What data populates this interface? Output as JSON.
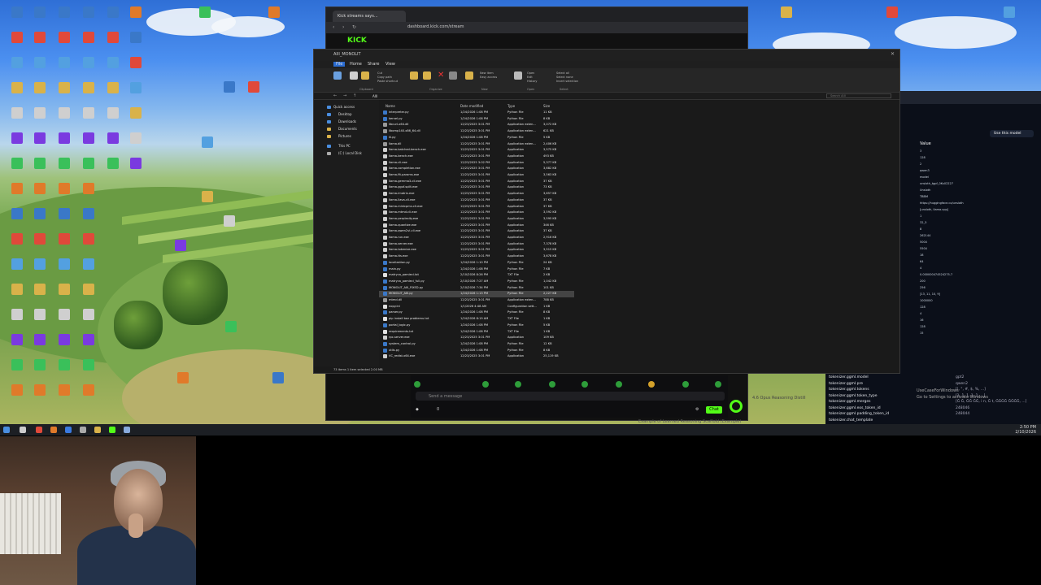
{
  "browser": {
    "tab_title": "Kick streams says...",
    "url": "dashboard.kick.com/stream"
  },
  "explorer": {
    "title": "AIII_MONOLIT",
    "menus": [
      "File",
      "Home",
      "Share",
      "View"
    ],
    "ribbon_groups": [
      "Clipboard",
      "Organize",
      "New",
      "Open",
      "Select"
    ],
    "ribbon_buttons": {
      "pin": "Pin to Quick access",
      "copy": "Copy",
      "paste": "Paste",
      "cut": "Cut",
      "copy_path": "Copy path",
      "paste_shortcut": "Paste shortcut",
      "move_to": "Move to",
      "copy_to": "Copy to",
      "delete": "Delete",
      "rename": "Rename",
      "new_folder": "New folder",
      "new_item": "New item",
      "easy_access": "Easy access",
      "properties": "Properties",
      "open": "Open",
      "edit": "Edit",
      "history": "History",
      "select_all": "Select all",
      "select_none": "Select none",
      "invert_selection": "Invert selection"
    },
    "path": "AIII",
    "search_placeholder": "Search AIII",
    "nav": [
      "Quick access",
      "Desktop",
      "Downloads",
      "Documents",
      "Pictures",
      "This PC",
      "(C:) Local Disk"
    ],
    "columns": [
      "Name",
      "Date modified",
      "Type",
      "Size"
    ],
    "files": [
      [
        "interpreter.py",
        "1/24/2026 1:08 PM",
        "Python File",
        "11 KB"
      ],
      [
        "kernel.py",
        "1/24/2026 1:08 PM",
        "Python File",
        "8 KB"
      ],
      [
        "libcurl-x64.dll",
        "12/23/2025 3:01 PM",
        "Application exten...",
        "3,072 KB"
      ],
      [
        "libomp140.x86_64.dll",
        "12/23/2025 3:01 PM",
        "Application exten...",
        "621 KB"
      ],
      [
        "lli.py",
        "1/24/2026 1:08 PM",
        "Python File",
        "5 KB"
      ],
      [
        "llama.dll",
        "12/23/2025 3:01 PM",
        "Application exten...",
        "2,406 KB"
      ],
      [
        "llama-batched-bench.exe",
        "12/23/2025 3:01 PM",
        "Application",
        "3,575 KB"
      ],
      [
        "llama-bench.exe",
        "12/23/2025 3:01 PM",
        "Application",
        "493 KB"
      ],
      [
        "llama-cli.exe",
        "12/23/2025 3:02 PM",
        "Application",
        "5,377 KB"
      ],
      [
        "llama-completion.exe",
        "12/23/2025 3:01 PM",
        "Application",
        "3,682 KB"
      ],
      [
        "llama-fit-params.exe",
        "12/23/2025 3:01 PM",
        "Application",
        "3,563 KB"
      ],
      [
        "llama-gemma3-cli.exe",
        "12/23/2025 3:01 PM",
        "Application",
        "37 KB"
      ],
      [
        "llama-gguf-split.exe",
        "12/23/2025 3:01 PM",
        "Application",
        "73 KB"
      ],
      [
        "llama-imatrix.exe",
        "12/23/2025 3:01 PM",
        "Application",
        "3,657 KB"
      ],
      [
        "llama-llava-cli.exe",
        "12/23/2025 3:01 PM",
        "Application",
        "37 KB"
      ],
      [
        "llama-minicpmv-cli.exe",
        "12/23/2025 3:01 PM",
        "Application",
        "37 KB"
      ],
      [
        "llama-mtmd-cli.exe",
        "12/23/2025 3:01 PM",
        "Application",
        "3,592 KB"
      ],
      [
        "llama-perplexity.exe",
        "12/23/2025 3:01 PM",
        "Application",
        "3,595 KB"
      ],
      [
        "llama-quantize.exe",
        "12/23/2025 3:01 PM",
        "Application",
        "346 KB"
      ],
      [
        "llama-qwen2vl-cli.exe",
        "12/23/2025 3:01 PM",
        "Application",
        "37 KB"
      ],
      [
        "llama-run.exe",
        "12/23/2025 3:01 PM",
        "Application",
        "2,916 KB"
      ],
      [
        "llama-server.exe",
        "12/23/2025 3:01 PM",
        "Application",
        "7,378 KB"
      ],
      [
        "llama-tokenize.exe",
        "12/23/2025 3:01 PM",
        "Application",
        "3,515 KB"
      ],
      [
        "llama-tts.exe",
        "12/23/2025 3:01 PM",
        "Application",
        "3,678 KB"
      ],
      [
        "localization.py",
        "1/24/2026 1:10 PM",
        "Python File",
        "24 KB"
      ],
      [
        "main.py",
        "1/24/2026 1:08 PM",
        "Python File",
        "7 KB"
      ],
      [
        "matryca_pamieci.txt",
        "2/10/2026 8:26 PM",
        "TXT File",
        "2 KB"
      ],
      [
        "matryca_pamieci_full.py",
        "2/10/2026 7:27 AM",
        "Python File",
        "1,042 KB"
      ],
      [
        "MONOLIT_AIII_FIXED.py",
        "2/10/2026 7:34 PM",
        "Python File",
        "101 KB"
      ],
      [
        "MONOLIT_AIII.py",
        "1/24/2026 1:13 PM",
        "Python File",
        "2,227 KB"
      ],
      [
        "mtmd.dll",
        "12/23/2025 3:01 PM",
        "Application exten...",
        "788 KB"
      ],
      [
        "nopy.ini",
        "1/1/2026 4:48 AM",
        "Configuration sett...",
        "1 KB"
      ],
      [
        "parser.py",
        "1/24/2026 1:08 PM",
        "Python File",
        "8 KB"
      ],
      [
        "pip install bez problemu.txt",
        "1/24/2026 8:19 AM",
        "TXT File",
        "1 KB"
      ],
      [
        "portal_logic.py",
        "1/24/2026 1:08 PM",
        "Python File",
        "5 KB"
      ],
      [
        "requirements.txt",
        "1/24/2026 1:08 PM",
        "TXT File",
        "1 KB"
      ],
      [
        "rpc-server.exe",
        "12/23/2025 3:01 PM",
        "Application",
        "109 KB"
      ],
      [
        "system_control.py",
        "1/24/2026 1:08 PM",
        "Python File",
        "12 KB"
      ],
      [
        "utils.py",
        "1/24/2026 1:08 PM",
        "Python File",
        "8 KB"
      ],
      [
        "VC_redist.x64.exe",
        "12/23/2025 3:01 PM",
        "Application",
        "25,119 KB"
      ]
    ],
    "selected_row": 29,
    "status": "73 items   1 item selected  2.00 MB"
  },
  "chat": {
    "placeholder": "Send a message",
    "send_label": "Chat",
    "viewer_count": "0",
    "kick_label": "KICK"
  },
  "hf_panel": {
    "use_model": "Use this model",
    "header": "Value",
    "values": [
      "3",
      "128",
      "2",
      "qwen3",
      "model",
      "unsloth_tgpf_0Ks02227",
      "Unsloth",
      "TBBM",
      "https://huggingface.co/unsloth",
      "[unsloth, llama.cpp]",
      "1",
      "32_5",
      "8",
      "262144",
      "5004",
      "5504",
      "18",
      "64",
      "4",
      "0.000000474524275-7",
      "200",
      "256",
      "[13, 11, 10, 9]",
      "1000000",
      "128",
      "4",
      "16",
      "128",
      "15"
    ]
  },
  "keylist": [
    [
      "tokenizer.ggml.model",
      "gpt2"
    ],
    [
      "tokenizer.ggml.pre",
      "qwen2"
    ],
    [
      "tokenizer.ggml.tokens",
      "[!, \", #, $, %, ...]"
    ],
    [
      "tokenizer.ggml.token_type",
      "[1, 1, 1, 1, 1, ...]"
    ],
    [
      "tokenizer.ggml.merges",
      "[Ġ Ġ, ĠĠ ĠĠ, i n, Ġ t, ĠĠĠĠ ĠĠĠĠ, ...]"
    ],
    [
      "tokenizer.ggml.eos_token_id",
      "248046"
    ],
    [
      "tokenizer.ggml.padding_token_id",
      "248044"
    ],
    [
      "tokenizer.chat_template",
      ""
    ]
  ],
  "keylist_overlay": [
    "UseCaseForWindows",
    "Go to Settings to activate Windows"
  ],
  "dim_text": "4.6 Opus Reasoning Distill",
  "below_text": "Example of Learned Reasoning Scaffold (Example)",
  "tray": {
    "time": "2:50 PM",
    "date": "2/10/2026"
  },
  "colors": {
    "kick_green": "#53fc18",
    "explorer_bg": "#1a1a1a",
    "hf_bg": "#0b0f19"
  }
}
